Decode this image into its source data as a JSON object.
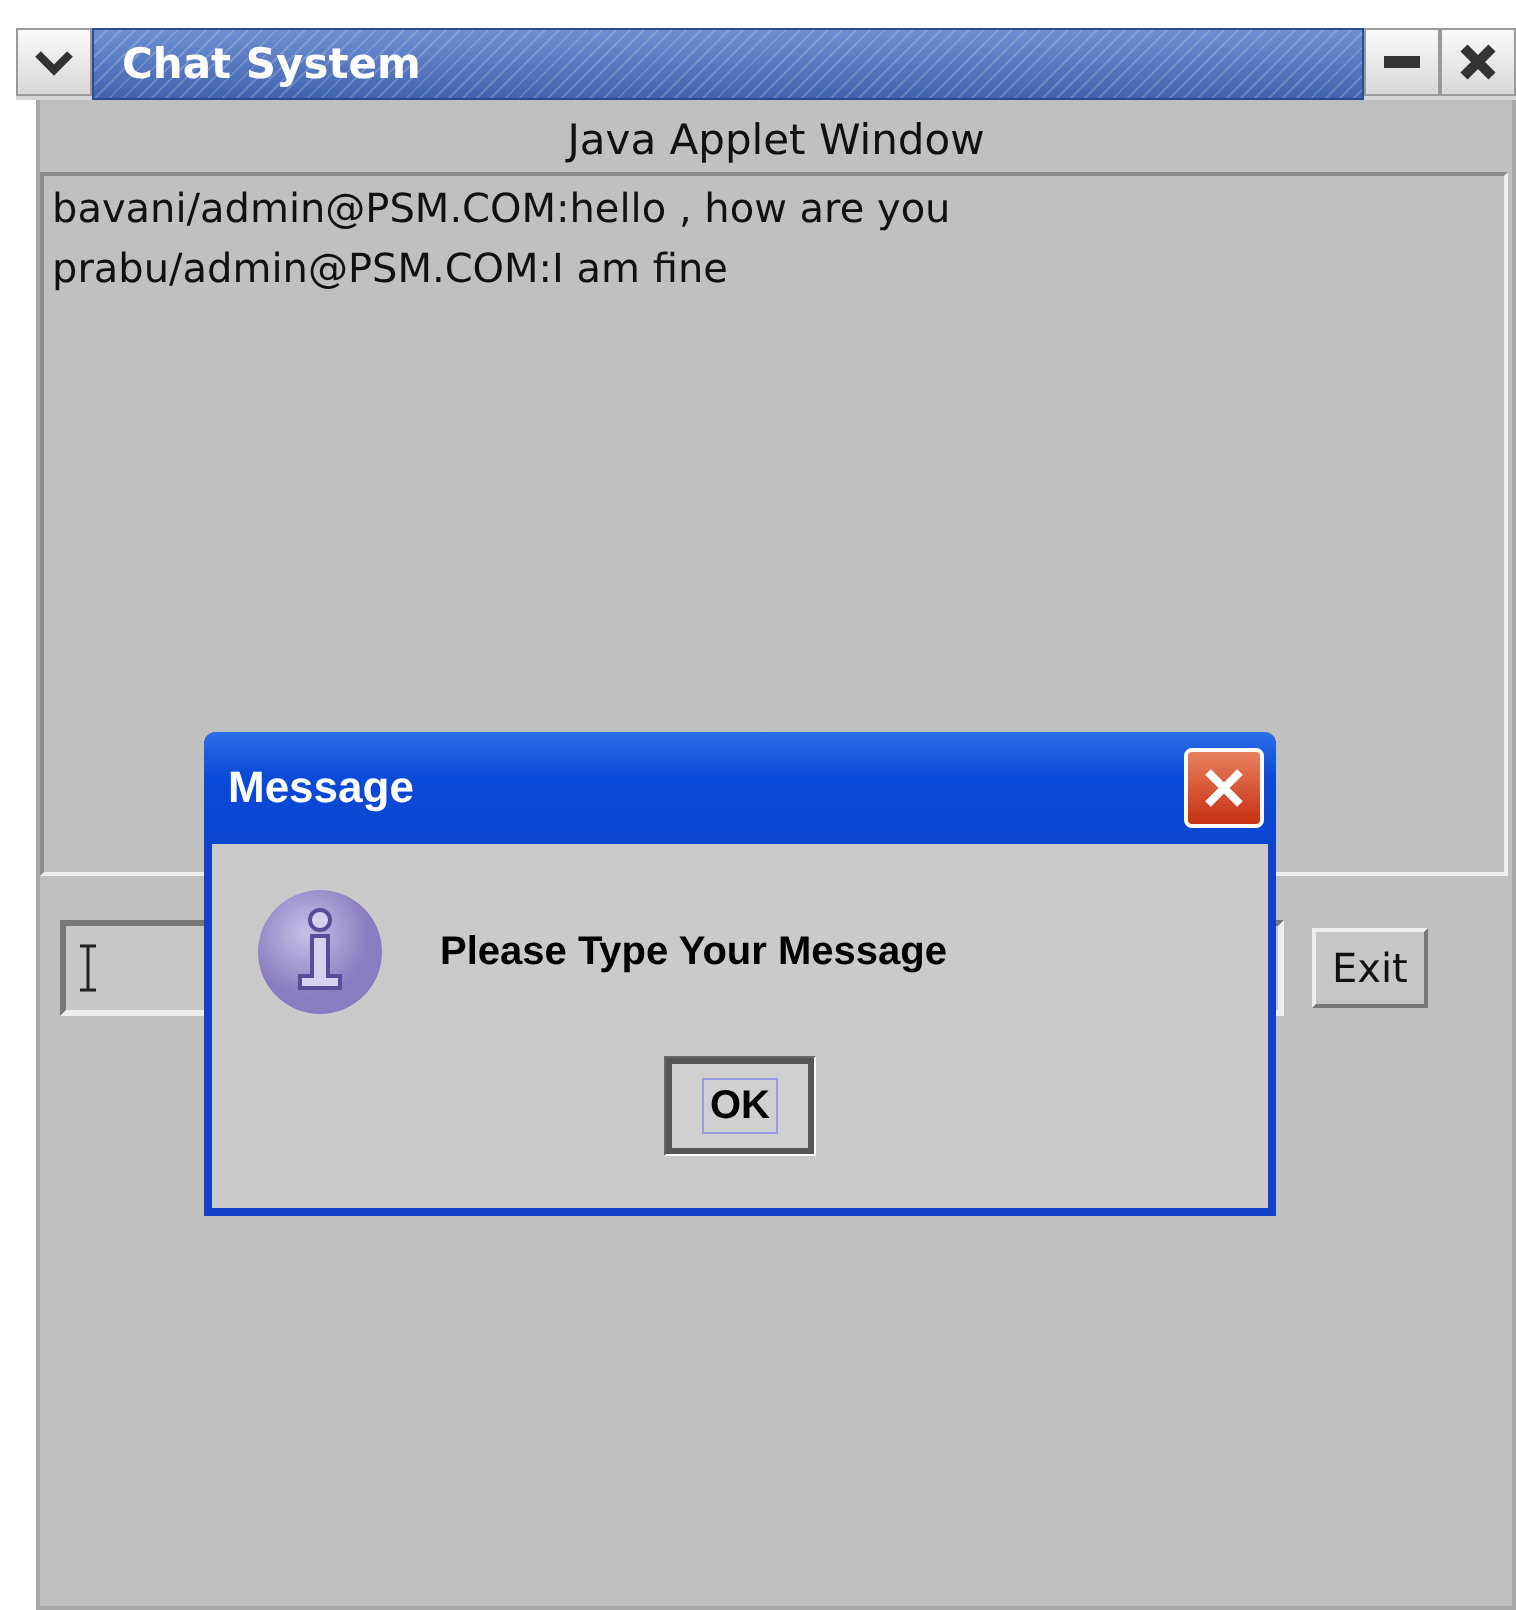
{
  "window": {
    "title": "Chat System"
  },
  "applet_label": "Java Applet Window",
  "messages": [
    "bavani/admin@PSM.COM:hello , how are you",
    "prabu/admin@PSM.COM:I am fine"
  ],
  "buttons": [
    {
      "label": "Exit"
    }
  ],
  "dialog": {
    "title": "Message",
    "text": "Please Type Your Message",
    "buttons": [
      {
        "label": "OK",
        "focused": true
      }
    ]
  }
}
